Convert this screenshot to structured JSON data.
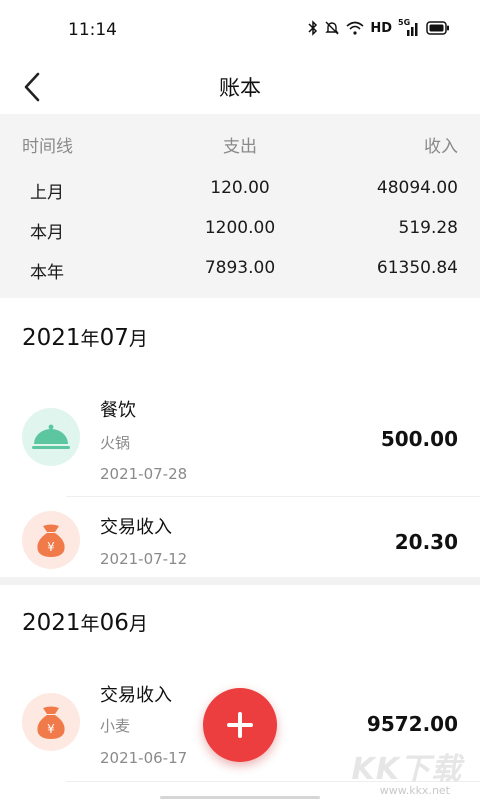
{
  "status": {
    "time": "11:14",
    "network": "HD",
    "signal_label": "5G"
  },
  "nav": {
    "title": "账本"
  },
  "summary": {
    "headers": [
      "时间线",
      "支出",
      "收入"
    ],
    "rows": [
      {
        "period": "上月",
        "expense": "120.00",
        "income": "48094.00"
      },
      {
        "period": "本月",
        "expense": "1200.00",
        "income": "519.28"
      },
      {
        "period": "本年",
        "expense": "7893.00",
        "income": "61350.84"
      }
    ]
  },
  "groups": [
    {
      "month_num": "2021",
      "month_year_char": "年",
      "month_m": "07",
      "month_char": "月",
      "items": [
        {
          "category": "餐饮",
          "note": "火锅",
          "date": "2021-07-28",
          "amount": "500.00",
          "icon": "cloche-icon",
          "color": "#5cc6a1"
        },
        {
          "category": "交易收入",
          "note": "",
          "date": "2021-07-12",
          "amount": "20.30",
          "icon": "money-bag-icon",
          "color": "#f07a4a"
        }
      ]
    },
    {
      "month_num": "2021",
      "month_year_char": "年",
      "month_m": "06",
      "month_char": "月",
      "items": [
        {
          "category": "交易收入",
          "note": "小麦",
          "date": "2021-06-17",
          "amount": "9572.00",
          "icon": "money-bag-icon",
          "color": "#f07a4a"
        }
      ]
    }
  ],
  "watermark": {
    "logo": "KK下载",
    "url": "www.kkx.net"
  }
}
